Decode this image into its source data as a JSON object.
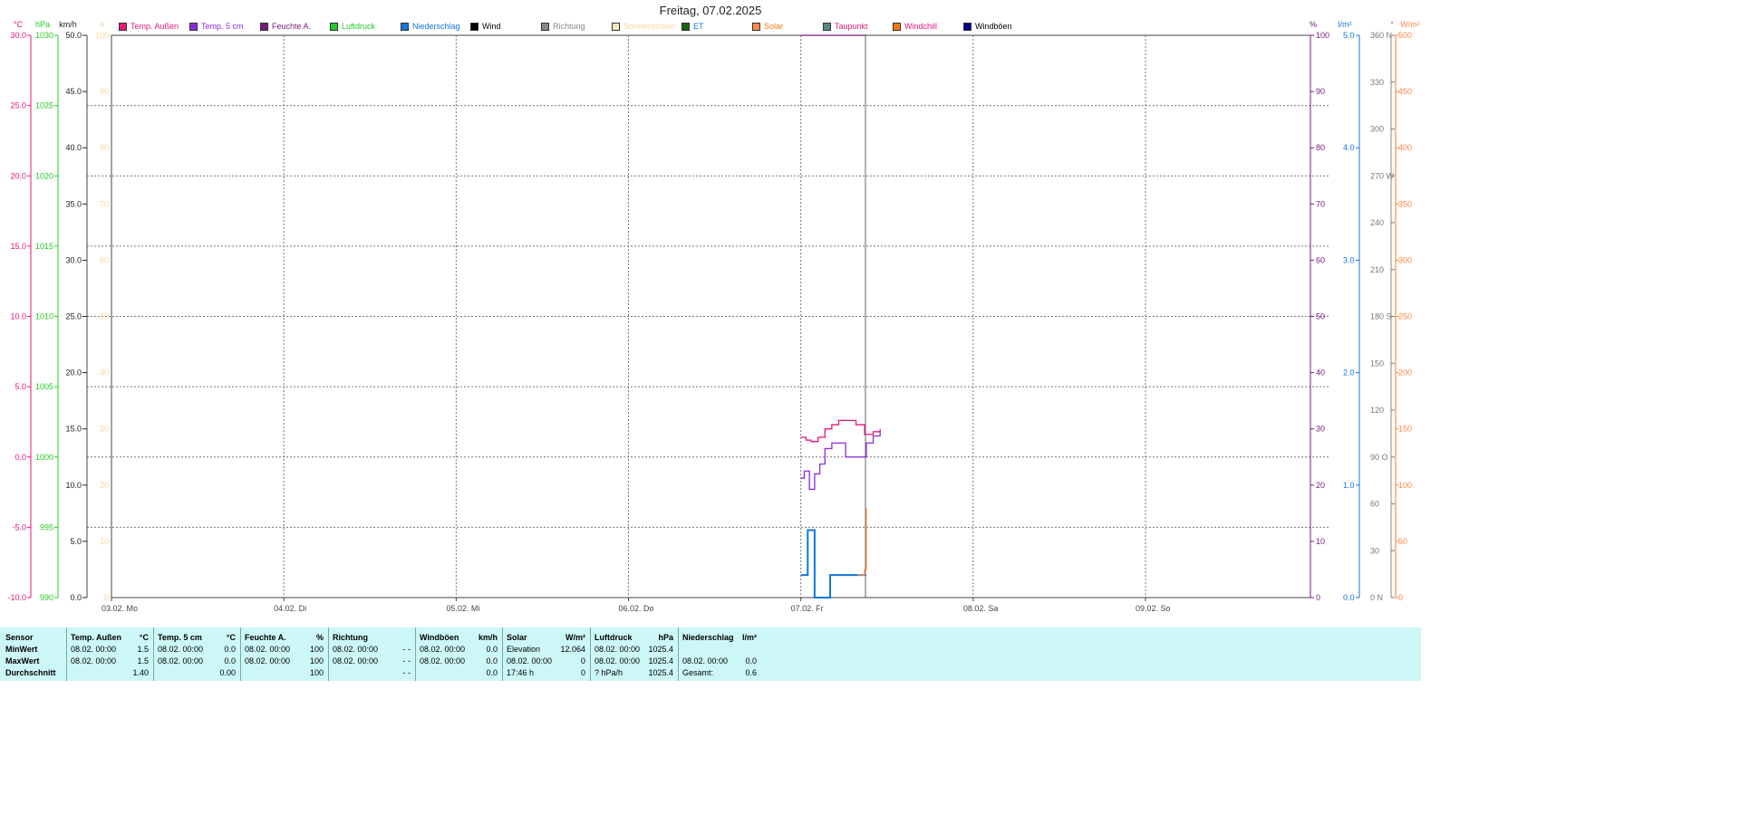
{
  "title": "Freitag, 07.02.2025",
  "colors": {
    "temp_aussen": "#e8157a",
    "temp_5cm": "#8b2be0",
    "feuchte": "#7a1a7a",
    "luftdruck": "#22cc22",
    "niederschlag": "#1177dd",
    "wind": "#000000",
    "richtung": "#888888",
    "sonnenschein": "#f5d7a0",
    "et": "#116611",
    "solar": "#ff8844",
    "taupunkt": "#558888",
    "windchill": "#ff7711",
    "windboeen": "#000088",
    "grid": "#888888",
    "stats_bg": "#ccf7f6"
  },
  "legend": [
    {
      "label": "Temp. Außen",
      "color": "#e8157a",
      "text_color": "#e8157a"
    },
    {
      "label": "Temp. 5 cm",
      "color": "#8b2be0",
      "text_color": "#8b2be0"
    },
    {
      "label": "Feuchte A.",
      "color": "#7a1a7a",
      "text_color": "#7a1a7a"
    },
    {
      "label": "Luftdruck",
      "color": "#22cc22",
      "text_color": "#22cc22"
    },
    {
      "label": "Niederschlag",
      "color": "#1177dd",
      "text_color": "#1177dd"
    },
    {
      "label": "Wind",
      "color": "#000000",
      "text_color": "#000000"
    },
    {
      "label": "Richtung",
      "color": "#888888",
      "text_color": "#888888"
    },
    {
      "label": "Sonnenschein",
      "color": "#fbe7c0",
      "text_color": "#f5d7a0"
    },
    {
      "label": "ET",
      "color": "#116611",
      "text_color": "#1177dd"
    },
    {
      "label": "Solar",
      "color": "#ff8844",
      "text_color": "#ff7711"
    },
    {
      "label": "Taupunkt",
      "color": "#558888",
      "text_color": "#e8157a"
    },
    {
      "label": "Windchill",
      "color": "#ff7711",
      "text_color": "#e8157a"
    },
    {
      "label": "Windböen",
      "color": "#000088",
      "text_color": "#000000"
    }
  ],
  "units": {
    "celsius": "°C",
    "hpa": "hPa",
    "kmh": "km/h",
    "hours": "h",
    "percent": "%",
    "lm2": "l/m²",
    "degree": "°",
    "wm2": "W/m²"
  },
  "chart_data": {
    "type": "line",
    "title": "Freitag, 07.02.2025",
    "x_tick_labels": [
      "03.02.  Mo",
      "04.02.  Di",
      "05.02.  Mi",
      "06.02.  Do",
      "07.02.  Fr",
      "08.02.  Sa",
      "09.02.  So"
    ],
    "x_range_days": [
      0,
      7
    ],
    "grid": true,
    "axes": {
      "celsius": {
        "range": [
          -10,
          30
        ],
        "ticks": [
          "-10.0",
          "-5.0",
          "0.0",
          "5.0",
          "10.0",
          "15.0",
          "20.0",
          "25.0",
          "30.0"
        ]
      },
      "hpa": {
        "range": [
          990,
          1030
        ],
        "ticks": [
          "990",
          "995",
          "1000",
          "1005",
          "1010",
          "1015",
          "1020",
          "1025",
          "1030"
        ]
      },
      "kmh": {
        "range": [
          0,
          50
        ],
        "ticks": [
          "0.0",
          "5.0",
          "10.0",
          "15.0",
          "20.0",
          "25.0",
          "30.0",
          "35.0",
          "40.0",
          "45.0",
          "50.0"
        ]
      },
      "hours": {
        "range": [
          0,
          100
        ],
        "ticks": [
          "0",
          "10",
          "20",
          "30",
          "40",
          "50",
          "60",
          "70",
          "80",
          "90",
          "100"
        ]
      },
      "percent": {
        "range": [
          0,
          100
        ],
        "ticks": [
          "0",
          "10",
          "20",
          "30",
          "40",
          "50",
          "60",
          "70",
          "80",
          "90",
          "100"
        ]
      },
      "lm2": {
        "range": [
          0,
          5
        ],
        "ticks": [
          "0.0",
          "1.0",
          "2.0",
          "3.0",
          "4.0",
          "5.0"
        ]
      },
      "degree": {
        "range": [
          0,
          360
        ],
        "ticks": [
          "0 N",
          "30",
          "60",
          "90 O",
          "120",
          "150",
          "180 S",
          "210",
          "240",
          "270 W",
          "300",
          "330",
          "360 N"
        ]
      },
      "wm2": {
        "range": [
          0,
          500
        ],
        "ticks": [
          "0",
          "50",
          "100",
          "150",
          "200",
          "250",
          "300",
          "350",
          "400",
          "450",
          "500"
        ]
      }
    },
    "series": [
      {
        "name": "Temp. Außen",
        "axis": "celsius",
        "color": "#e8157a",
        "x": [
          4.0,
          4.03,
          4.06,
          4.1,
          4.14,
          4.18,
          4.22,
          4.27,
          4.32,
          4.37,
          4.42,
          4.46
        ],
        "y": [
          1.4,
          1.2,
          1.1,
          1.4,
          2.0,
          2.3,
          2.6,
          2.6,
          2.3,
          1.6,
          1.8,
          2.0
        ]
      },
      {
        "name": "Temp. 5 cm",
        "axis": "celsius",
        "color": "#8b2be0",
        "x": [
          4.0,
          4.02,
          4.05,
          4.08,
          4.11,
          4.14,
          4.18,
          4.22,
          4.26,
          4.3,
          4.34,
          4.38,
          4.42,
          4.46
        ],
        "y": [
          -1.5,
          -1.0,
          -2.3,
          -1.2,
          -0.5,
          0.6,
          1.0,
          1.0,
          0.0,
          0.0,
          0.0,
          1.0,
          1.5,
          1.9
        ]
      },
      {
        "name": "Feuchte A.",
        "axis": "percent",
        "color": "#7a1a7a",
        "x": [
          4.0,
          4.38
        ],
        "y": [
          100,
          100
        ]
      },
      {
        "name": "Niederschlag",
        "axis": "lm2",
        "color": "#1177dd",
        "x": [
          4.0,
          4.04,
          4.04,
          4.08,
          4.08,
          4.17,
          4.17,
          4.38
        ],
        "y": [
          0.2,
          0.2,
          0.6,
          0.6,
          0.0,
          0.0,
          0.2,
          0.2
        ]
      },
      {
        "name": "Solar",
        "axis": "wm2",
        "color": "#ff8844",
        "x": [
          4.33,
          4.37,
          4.38,
          4.38
        ],
        "y": [
          20,
          25,
          25,
          80
        ]
      }
    ],
    "now_line_day": 4.375
  },
  "stats": {
    "columns": [
      {
        "header": "Sensor",
        "unit": "",
        "rows": [
          {
            "label": "MinWert"
          },
          {
            "label": "MaxWert"
          },
          {
            "label": "Durchschnitt"
          }
        ]
      },
      {
        "header": "Temp. Außen",
        "unit": "°C",
        "rows": [
          {
            "time": "08.02.  00:00",
            "value": "1.5"
          },
          {
            "time": "08.02.  00:00",
            "value": "1.5"
          },
          {
            "time": "",
            "value": "1.40"
          }
        ]
      },
      {
        "header": "Temp. 5 cm",
        "unit": "°C",
        "rows": [
          {
            "time": "08.02.  00:00",
            "value": "0.0"
          },
          {
            "time": "08.02.  00:00",
            "value": "0.0"
          },
          {
            "time": "",
            "value": "0.00"
          }
        ]
      },
      {
        "header": "Feuchte A.",
        "unit": "%",
        "rows": [
          {
            "time": "08.02.  00:00",
            "value": "100"
          },
          {
            "time": "08.02.  00:00",
            "value": "100"
          },
          {
            "time": "",
            "value": "100"
          }
        ]
      },
      {
        "header": "Richtung",
        "unit": "",
        "rows": [
          {
            "time": "08.02.  00:00",
            "value": "- -"
          },
          {
            "time": "08.02.  00:00",
            "value": "- -"
          },
          {
            "time": "",
            "value": "- -"
          }
        ]
      },
      {
        "header": "Windböen",
        "unit": "km/h",
        "rows": [
          {
            "time": "08.02.  00:00",
            "value": "0.0"
          },
          {
            "time": "08.02.  00:00",
            "value": "0.0"
          },
          {
            "time": "",
            "value": "0.0"
          }
        ]
      },
      {
        "header": "Solar",
        "unit": "W/m²",
        "rows": [
          {
            "time": "Elevation",
            "value": "12.064"
          },
          {
            "time": "08.02.  00:00",
            "value": "0"
          },
          {
            "time": "17:46 h",
            "value": "0"
          }
        ]
      },
      {
        "header": "Luftdruck",
        "unit": "hPa",
        "rows": [
          {
            "time": "08.02.  00:00",
            "value": "1025.4"
          },
          {
            "time": "08.02.  00:00",
            "value": "1025.4"
          },
          {
            "time": "? hPa/h",
            "value": "1025.4"
          }
        ]
      },
      {
        "header": "Niederschlag",
        "unit": "l/m²",
        "rows": [
          {
            "time": "",
            "value": ""
          },
          {
            "time": "08.02.  00:00",
            "value": "0.0"
          },
          {
            "time": "Gesamt:",
            "value": "0.6"
          }
        ]
      }
    ]
  }
}
